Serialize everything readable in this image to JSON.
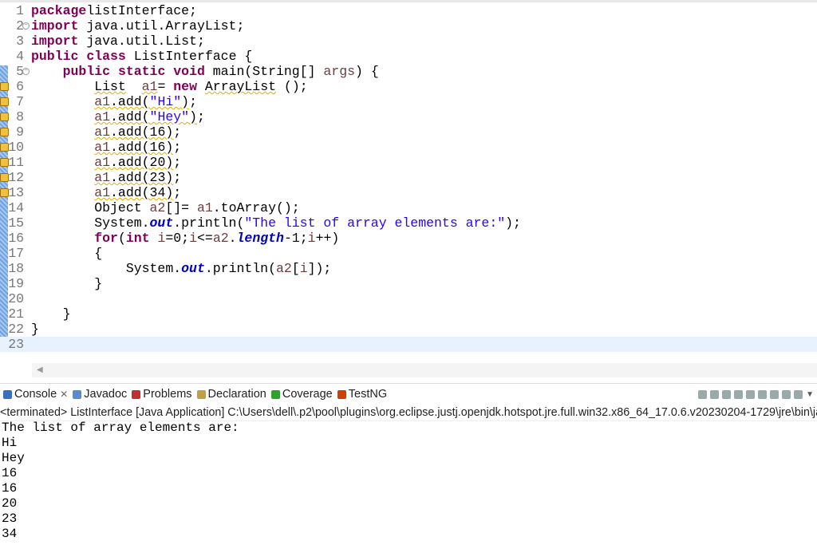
{
  "editor": {
    "lines": [
      [
        [
          "kw",
          "package"
        ],
        [
          "",
          "listInterface;"
        ]
      ],
      [
        [
          "kw",
          "import"
        ],
        [
          "",
          " java.util.ArrayList;"
        ]
      ],
      [
        [
          "kw",
          "import"
        ],
        [
          "",
          " java.util.List;"
        ]
      ],
      [
        [
          "kw",
          "public"
        ],
        [
          "",
          " "
        ],
        [
          "kw",
          "class"
        ],
        [
          "",
          " ListInterface {"
        ]
      ],
      [
        [
          "",
          "    "
        ],
        [
          "kw",
          "public"
        ],
        [
          "",
          " "
        ],
        [
          "kw",
          "static"
        ],
        [
          "",
          " "
        ],
        [
          "kw",
          "void"
        ],
        [
          "",
          " main(String[] "
        ],
        [
          "var",
          "args"
        ],
        [
          "",
          ") {"
        ]
      ],
      [
        [
          "",
          "        "
        ],
        [
          "warn",
          "List"
        ],
        [
          "",
          "  "
        ],
        [
          "var warn",
          "a1"
        ],
        [
          "",
          "= "
        ],
        [
          "kw",
          "new"
        ],
        [
          "",
          " "
        ],
        [
          "warn",
          "ArrayList"
        ],
        [
          "",
          " ();"
        ]
      ],
      [
        [
          "",
          "        "
        ],
        [
          "var warn",
          "a1"
        ],
        [
          "warn",
          ".add("
        ],
        [
          "str warn",
          "\"Hi\""
        ],
        [
          "warn",
          ")"
        ],
        [
          "",
          ";"
        ]
      ],
      [
        [
          "",
          "        "
        ],
        [
          "var warn",
          "a1"
        ],
        [
          "warn",
          ".add("
        ],
        [
          "str warn",
          "\"Hey\""
        ],
        [
          "warn",
          ")"
        ],
        [
          "",
          ";"
        ]
      ],
      [
        [
          "",
          "        "
        ],
        [
          "var warn",
          "a1"
        ],
        [
          "warn",
          ".add(16)"
        ],
        [
          "",
          ";"
        ]
      ],
      [
        [
          "",
          "        "
        ],
        [
          "var warn",
          "a1"
        ],
        [
          "warn",
          ".add(16)"
        ],
        [
          "",
          ";"
        ]
      ],
      [
        [
          "",
          "        "
        ],
        [
          "var warn",
          "a1"
        ],
        [
          "warn",
          ".add(20)"
        ],
        [
          "",
          ";"
        ]
      ],
      [
        [
          "",
          "        "
        ],
        [
          "var warn",
          "a1"
        ],
        [
          "warn",
          ".add(23)"
        ],
        [
          "",
          ";"
        ]
      ],
      [
        [
          "",
          "        "
        ],
        [
          "var warn",
          "a1"
        ],
        [
          "warn",
          ".add(34)"
        ],
        [
          "",
          ";"
        ]
      ],
      [
        [
          "",
          "        Object "
        ],
        [
          "var",
          "a2"
        ],
        [
          "",
          "[]= "
        ],
        [
          "var",
          "a1"
        ],
        [
          "",
          ".toArray();"
        ]
      ],
      [
        [
          "",
          "        System."
        ],
        [
          "fld",
          "out"
        ],
        [
          "",
          ".println("
        ],
        [
          "str",
          "\"The list of array elements are:\""
        ],
        [
          "",
          ");"
        ]
      ],
      [
        [
          "",
          "        "
        ],
        [
          "kw",
          "for"
        ],
        [
          "",
          "("
        ],
        [
          "kw",
          "int"
        ],
        [
          "",
          " "
        ],
        [
          "var",
          "i"
        ],
        [
          "",
          "=0;"
        ],
        [
          "var",
          "i"
        ],
        [
          "",
          "<="
        ],
        [
          "var",
          "a2"
        ],
        [
          "",
          "."
        ],
        [
          "fld",
          "length"
        ],
        [
          "",
          "-1;"
        ],
        [
          "var",
          "i"
        ],
        [
          "",
          "++)"
        ]
      ],
      [
        [
          "",
          "        {"
        ]
      ],
      [
        [
          "",
          "            System."
        ],
        [
          "fld",
          "out"
        ],
        [
          "",
          ".println("
        ],
        [
          "var",
          "a2"
        ],
        [
          "",
          "["
        ],
        [
          "var",
          "i"
        ],
        [
          "",
          "]);"
        ]
      ],
      [
        [
          "",
          "        }"
        ]
      ],
      [
        [
          "",
          ""
        ]
      ],
      [
        [
          "",
          "    }"
        ]
      ],
      [
        [
          "",
          "}"
        ]
      ],
      [
        [
          "",
          ""
        ]
      ]
    ],
    "fold_lines": [
      2,
      5
    ],
    "warning_lines": [
      6,
      7,
      8,
      9,
      10,
      11,
      12,
      13
    ],
    "current_line": 23
  },
  "tabs": [
    {
      "label": "Console",
      "icon": "console-icon",
      "active": true,
      "color": "#3a6fc0"
    },
    {
      "label": "Javadoc",
      "icon": "javadoc-icon",
      "color": "#5a8ad0"
    },
    {
      "label": "Problems",
      "icon": "problems-icon",
      "color": "#c03030"
    },
    {
      "label": "Declaration",
      "icon": "declaration-icon",
      "color": "#c0a040"
    },
    {
      "label": "Coverage",
      "icon": "coverage-icon",
      "color": "#30a030"
    },
    {
      "label": "TestNG",
      "icon": "testng-icon",
      "color": "#d04000"
    }
  ],
  "console": {
    "status": "<terminated> ListInterface [Java Application] C:\\Users\\dell\\.p2\\pool\\plugins\\org.eclipse.justj.openjdk.hotspot.jre.full.win32.x86_64_17.0.6.v20230204-1729\\jre\\bin\\javaw.exe",
    "output": [
      "The list of array elements are:",
      "Hi",
      "Hey",
      "16",
      "16",
      "20",
      "23",
      "34"
    ]
  }
}
